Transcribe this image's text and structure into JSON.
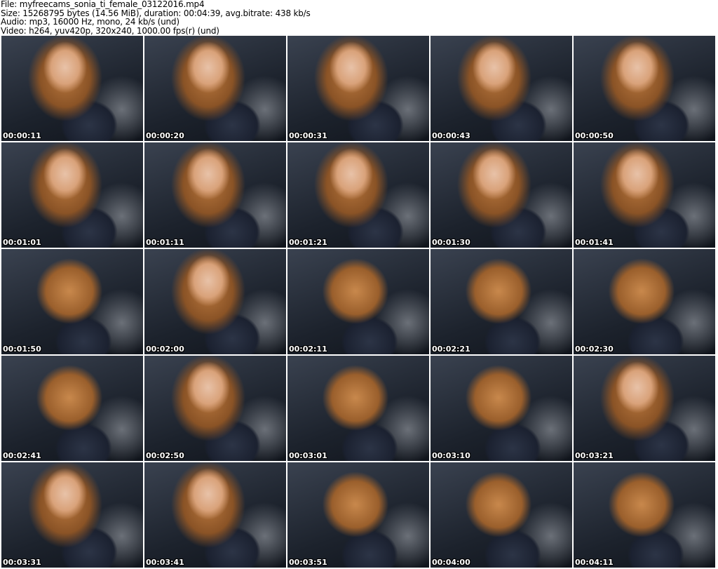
{
  "header": {
    "file": "File: myfreecams_sonia_ti_female_03122016.mp4",
    "size": "Size: 15268795 bytes (14.56 MiB), duration: 00:04:39, avg.bitrate: 438 kb/s",
    "audio": "Audio: mp3, 16000 Hz, mono, 24 kb/s (und)",
    "video": "Video: h264, yuv420p, 320x240, 1000.00 fps(r) (und)"
  },
  "thumbnails": [
    {
      "time": "00:00:11"
    },
    {
      "time": "00:00:20"
    },
    {
      "time": "00:00:31"
    },
    {
      "time": "00:00:43"
    },
    {
      "time": "00:00:50"
    },
    {
      "time": "00:01:01"
    },
    {
      "time": "00:01:11"
    },
    {
      "time": "00:01:21"
    },
    {
      "time": "00:01:30"
    },
    {
      "time": "00:01:41"
    },
    {
      "time": "00:01:50"
    },
    {
      "time": "00:02:00"
    },
    {
      "time": "00:02:11"
    },
    {
      "time": "00:02:21"
    },
    {
      "time": "00:02:30"
    },
    {
      "time": "00:02:41"
    },
    {
      "time": "00:02:50"
    },
    {
      "time": "00:03:01"
    },
    {
      "time": "00:03:10"
    },
    {
      "time": "00:03:21"
    },
    {
      "time": "00:03:31"
    },
    {
      "time": "00:03:41"
    },
    {
      "time": "00:03:51"
    },
    {
      "time": "00:04:00"
    },
    {
      "time": "00:04:11"
    }
  ]
}
